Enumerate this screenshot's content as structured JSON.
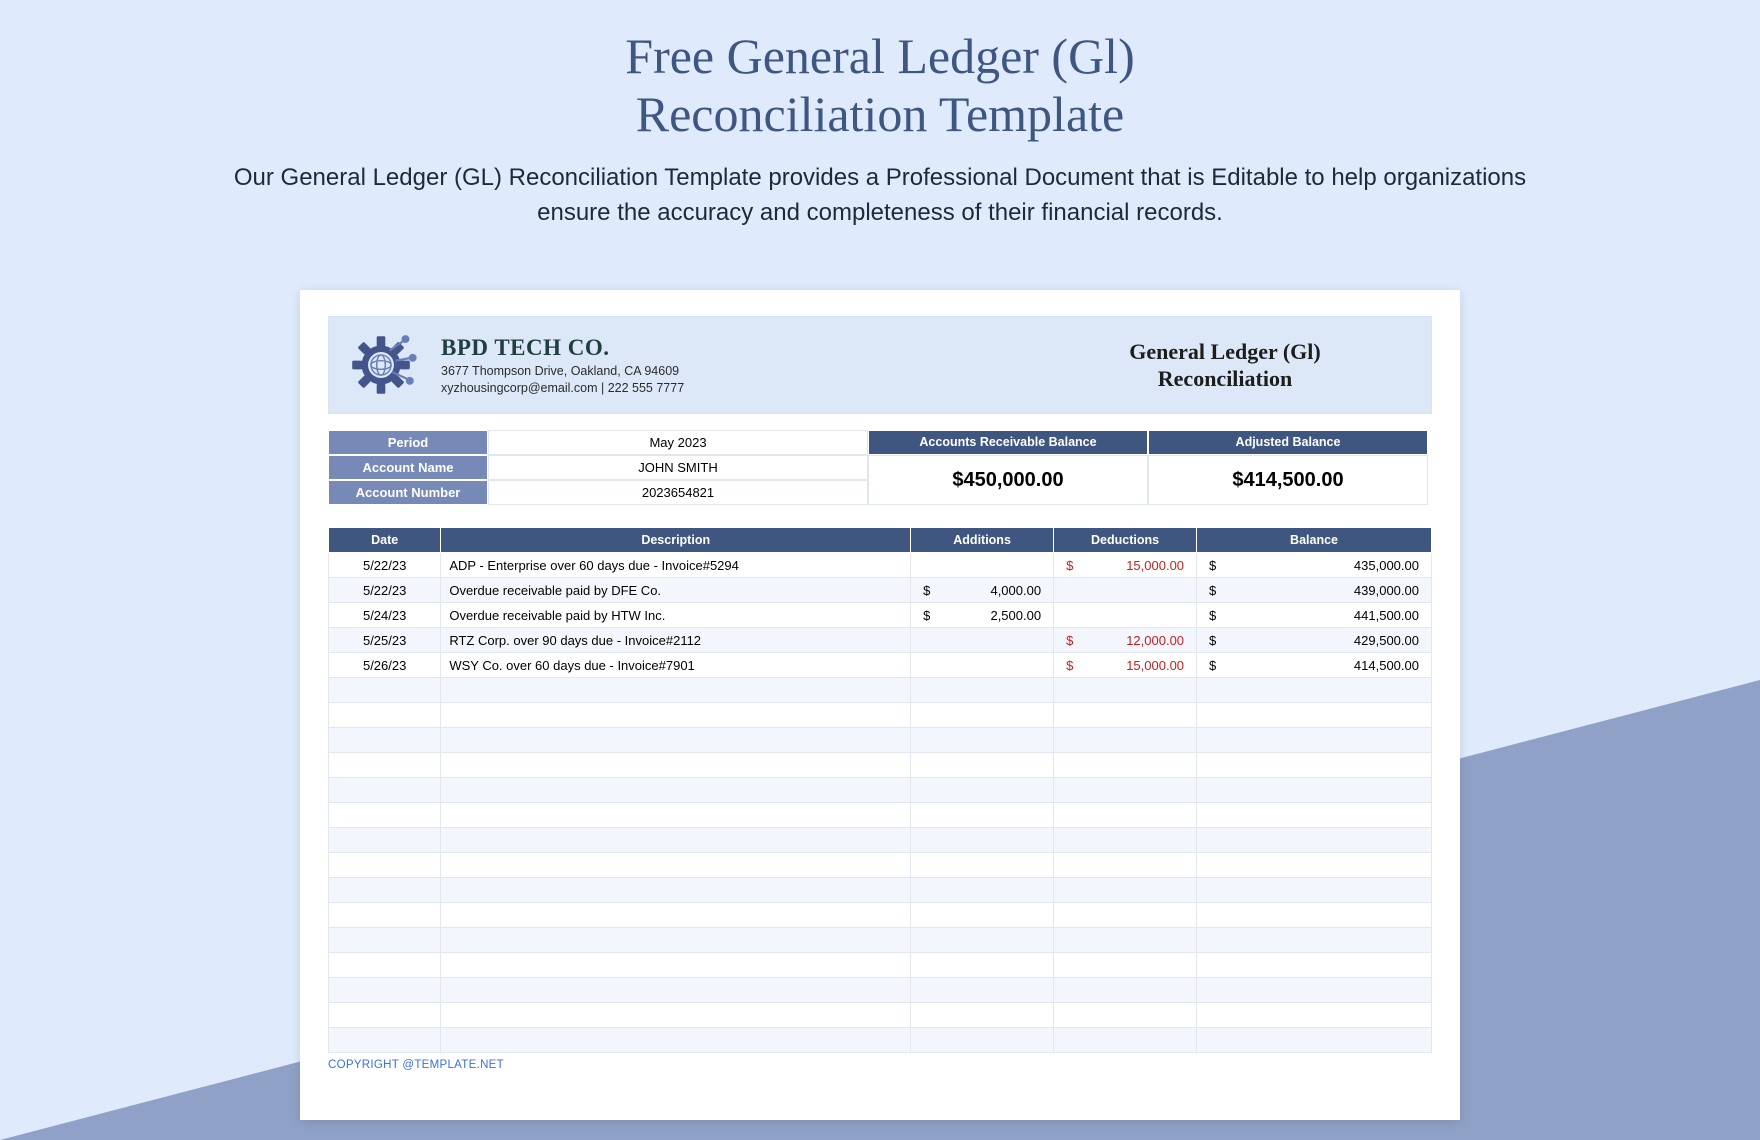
{
  "page": {
    "title_line1": "Free General Ledger (Gl)",
    "title_line2": "Reconciliation Template",
    "subtitle": "Our General Ledger (GL) Reconciliation Template provides a Professional Document that is Editable to help organizations ensure the accuracy and completeness of their financial records."
  },
  "company": {
    "name": "BPD TECH CO.",
    "address": "3677 Thompson Drive, Oakland, CA 94609",
    "contact": "xyzhousingcorp@email.com | 222 555 7777"
  },
  "doc_title_line1": "General Ledger (Gl)",
  "doc_title_line2": "Reconciliation",
  "summary": {
    "labels": {
      "period": "Period",
      "account_name": "Account Name",
      "account_number": "Account Number"
    },
    "period": "May 2023",
    "account_name": "JOHN SMITH",
    "account_number": "2023654821",
    "ar_label": "Accounts Receivable Balance",
    "ar_value": "$450,000.00",
    "adj_label": "Adjusted Balance",
    "adj_value": "$414,500.00"
  },
  "table": {
    "headers": {
      "date": "Date",
      "desc": "Description",
      "add": "Additions",
      "ded": "Deductions",
      "bal": "Balance"
    },
    "rows": [
      {
        "date": "5/22/23",
        "desc": "ADP - Enterprise over 60 days due - Invoice#5294",
        "add": "",
        "ded": "15,000.00",
        "bal": "435,000.00"
      },
      {
        "date": "5/22/23",
        "desc": "Overdue receivable paid by DFE Co.",
        "add": "4,000.00",
        "ded": "",
        "bal": "439,000.00"
      },
      {
        "date": "5/24/23",
        "desc": "Overdue receivable paid by HTW Inc.",
        "add": "2,500.00",
        "ded": "",
        "bal": "441,500.00"
      },
      {
        "date": "5/25/23",
        "desc": "RTZ Corp. over 90 days due - Invoice#2112",
        "add": "",
        "ded": "12,000.00",
        "bal": "429,500.00"
      },
      {
        "date": "5/26/23",
        "desc": "WSY Co. over 60 days due - Invoice#7901",
        "add": "",
        "ded": "15,000.00",
        "bal": "414,500.00"
      }
    ],
    "empty_rows": 15
  },
  "currency": "$",
  "copyright": "COPYRIGHT @TEMPLATE.NET",
  "colors": {
    "accent": "#3e5680",
    "accent_light": "#7789b6",
    "panel": "#dce8f8",
    "red": "#c62020"
  }
}
